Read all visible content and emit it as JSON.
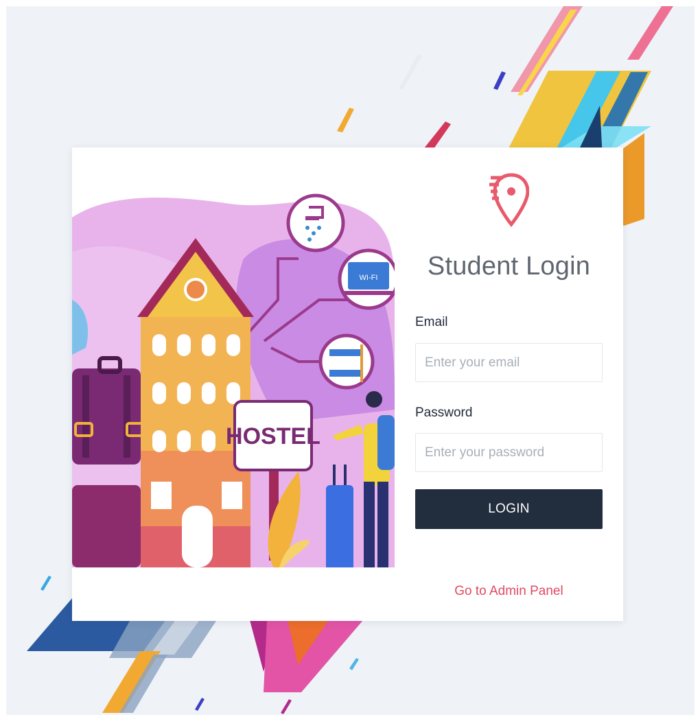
{
  "colors": {
    "page_bg": "#eff3f8",
    "accent": "#e04a64",
    "button_bg": "#222d3d",
    "title": "#5f6670",
    "label": "#1f2937"
  },
  "illustration": {
    "sign_text": "HOSTEL",
    "wifi_text": "WI-FI"
  },
  "form": {
    "logo_icon": "location-pin-icon",
    "title": "Student Login",
    "email_label": "Email",
    "email_placeholder": "Enter your email",
    "email_value": "",
    "password_label": "Password",
    "password_placeholder": "Enter your password",
    "password_value": "",
    "login_label": "LOGIN",
    "admin_link": "Go to Admin Panel"
  }
}
